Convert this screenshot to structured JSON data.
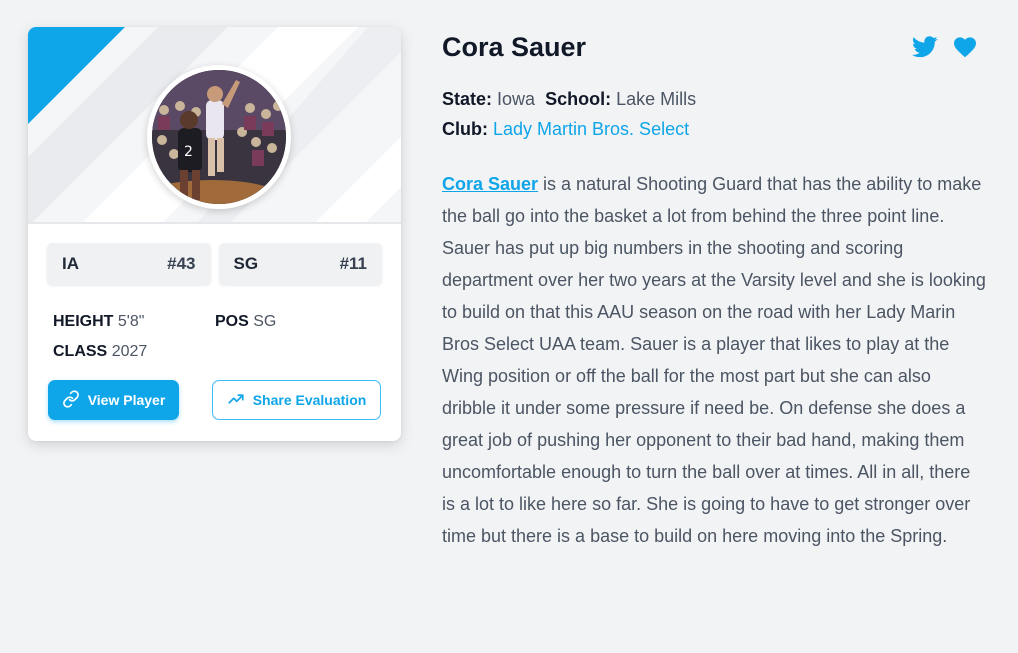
{
  "player": {
    "name": "Cora Sauer",
    "state_label": "State:",
    "state": "Iowa",
    "school_label": "School:",
    "school": "Lake Mills",
    "club_label": "Club:",
    "club": "Lady Martin Bros. Select"
  },
  "card": {
    "badges": [
      {
        "label": "IA",
        "rank": "#43"
      },
      {
        "label": "SG",
        "rank": "#11"
      }
    ],
    "height_label": "HEIGHT",
    "height": "5'8\"",
    "pos_label": "POS",
    "pos": "SG",
    "class_label": "CLASS",
    "class": "2027",
    "view_button": "View Player",
    "share_button": "Share Evaluation",
    "photo_icon": "player-photo"
  },
  "bio": {
    "link_text": "Cora Sauer",
    "text": " is a natural Shooting Guard that has the ability to make the ball go into the basket a lot from behind the three point line. Sauer has put up big numbers in the shooting and scoring department over her two years at the Varsity level and she is looking to build on that this AAU season on the road with her Lady Marin Bros Select UAA team. Sauer is a player that likes to play at the Wing position or off the ball for the most part but she can also dribble it under some pressure if need be. On defense she does a great job of pushing her opponent to their bad hand, making them uncomfortable enough to turn the ball over at times. All in all, there is a lot to like here so far. She is going to have to get stronger over time but there is a base to build on here moving into the Spring."
  },
  "social": {
    "twitter_icon": "twitter-icon",
    "heart_icon": "heart-icon"
  },
  "colors": {
    "accent": "#0ea5e9",
    "background": "#f2f3f5",
    "card": "#ffffff"
  }
}
